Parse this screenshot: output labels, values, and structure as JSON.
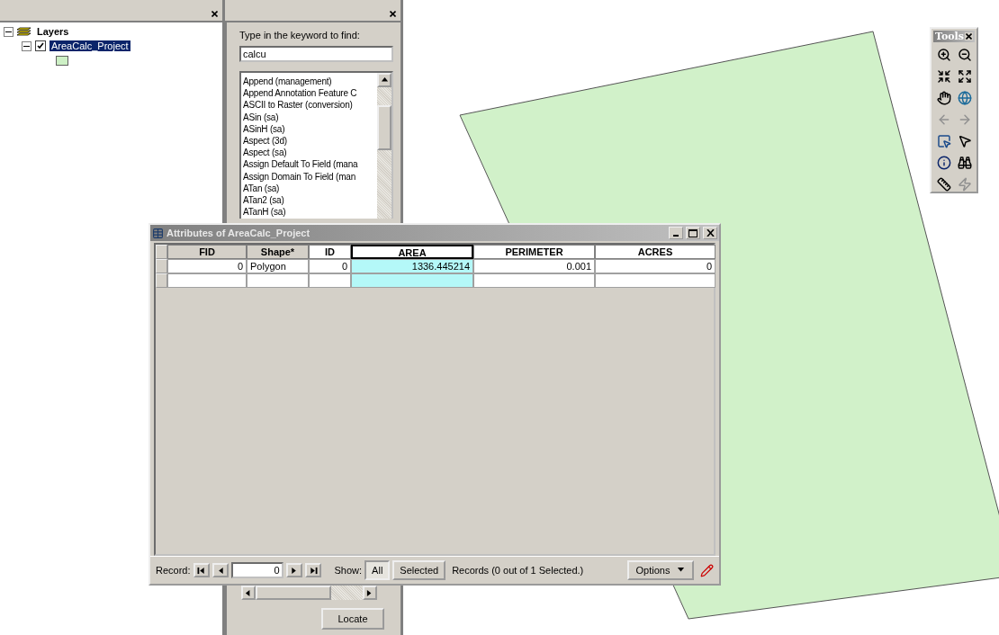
{
  "toc": {
    "root": {
      "label": "Layers",
      "expanded": true,
      "children": [
        {
          "label": "AreaCalc_Project",
          "expanded": true,
          "checked": true,
          "selected": true
        }
      ]
    }
  },
  "search": {
    "prompt": "Type in the keyword to find:",
    "value": "calcu",
    "items": [
      {
        "label": "Append (management)"
      },
      {
        "label": "Append Annotation Feature C"
      },
      {
        "label": "ASCII to Raster (conversion)"
      },
      {
        "label": "ASin (sa)"
      },
      {
        "label": "ASinH (sa)"
      },
      {
        "label": "Aspect (3d)"
      },
      {
        "label": "Aspect (sa)"
      },
      {
        "label": "Assign Default To Field (mana"
      },
      {
        "label": "Assign Domain To Field (man"
      },
      {
        "label": "ATan (sa)"
      },
      {
        "label": "ATan2 (sa)"
      },
      {
        "label": "ATanH (sa)"
      }
    ],
    "button": "Locate"
  },
  "tools": {
    "title": "Tools"
  },
  "attributes": {
    "title": "Attributes of AreaCalc_Project",
    "columns": [
      {
        "label": "FID",
        "kind": "system",
        "selected": false
      },
      {
        "label": "Shape*",
        "kind": "system",
        "selected": false
      },
      {
        "label": "ID",
        "kind": "user",
        "selected": false
      },
      {
        "label": "AREA",
        "kind": "user",
        "selected": true
      },
      {
        "label": "PERIMETER",
        "kind": "user",
        "selected": false
      },
      {
        "label": "ACRES",
        "kind": "user",
        "selected": false
      }
    ],
    "rows": [
      [
        "0",
        "Polygon",
        "0",
        "1336.445214",
        "0.001",
        "0"
      ]
    ],
    "footer": {
      "record_label": "Record:",
      "record_value": "0",
      "show_label": "Show:",
      "show_options": [
        {
          "label": "All",
          "selected": true
        },
        {
          "label": "Selected",
          "selected": false
        }
      ],
      "status": "Records  (0 out of 1 Selected.)",
      "options": "Options"
    }
  }
}
